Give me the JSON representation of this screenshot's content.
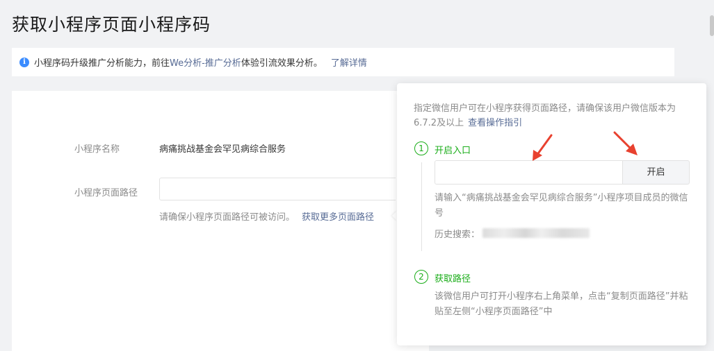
{
  "header": {
    "title": "获取小程序页面小程序码"
  },
  "notice": {
    "icon": "info-icon",
    "text_before": "小程序码升级推广分析能力，前往",
    "link_we": "We分析-推广分析",
    "text_after": "体验引流效果分析。",
    "link_more": "了解详情"
  },
  "form": {
    "name_label": "小程序名称",
    "name_value": "病痛挑战基金会罕见病综合服务",
    "path_label": "小程序页面路径",
    "path_value": "",
    "hint_text": "请确保小程序页面路径可被访问。",
    "hint_link": "获取更多页面路径"
  },
  "popover": {
    "desc": "指定微信用户可在小程序获得页面路径，请确保该用户微信版本为6.7.2及以上",
    "guide_link": "查看操作指引",
    "step1": {
      "num": "1",
      "title": "开启入口",
      "input_value": "",
      "button_label": "开启",
      "help": "请输入“病痛挑战基金会罕见病综合服务”小程序项目成员的微信号",
      "history_label": "历史搜索："
    },
    "step2": {
      "num": "2",
      "title": "获取路径",
      "desc": "该微信用户可打开小程序右上角菜单，点击“复制页面路径”并粘贴至左侧“小程序页面路径”中"
    }
  },
  "colors": {
    "accent_green": "#1aad19",
    "link_blue": "#576b95",
    "annotation_red": "#e8412f",
    "info_blue": "#3b8cff"
  }
}
